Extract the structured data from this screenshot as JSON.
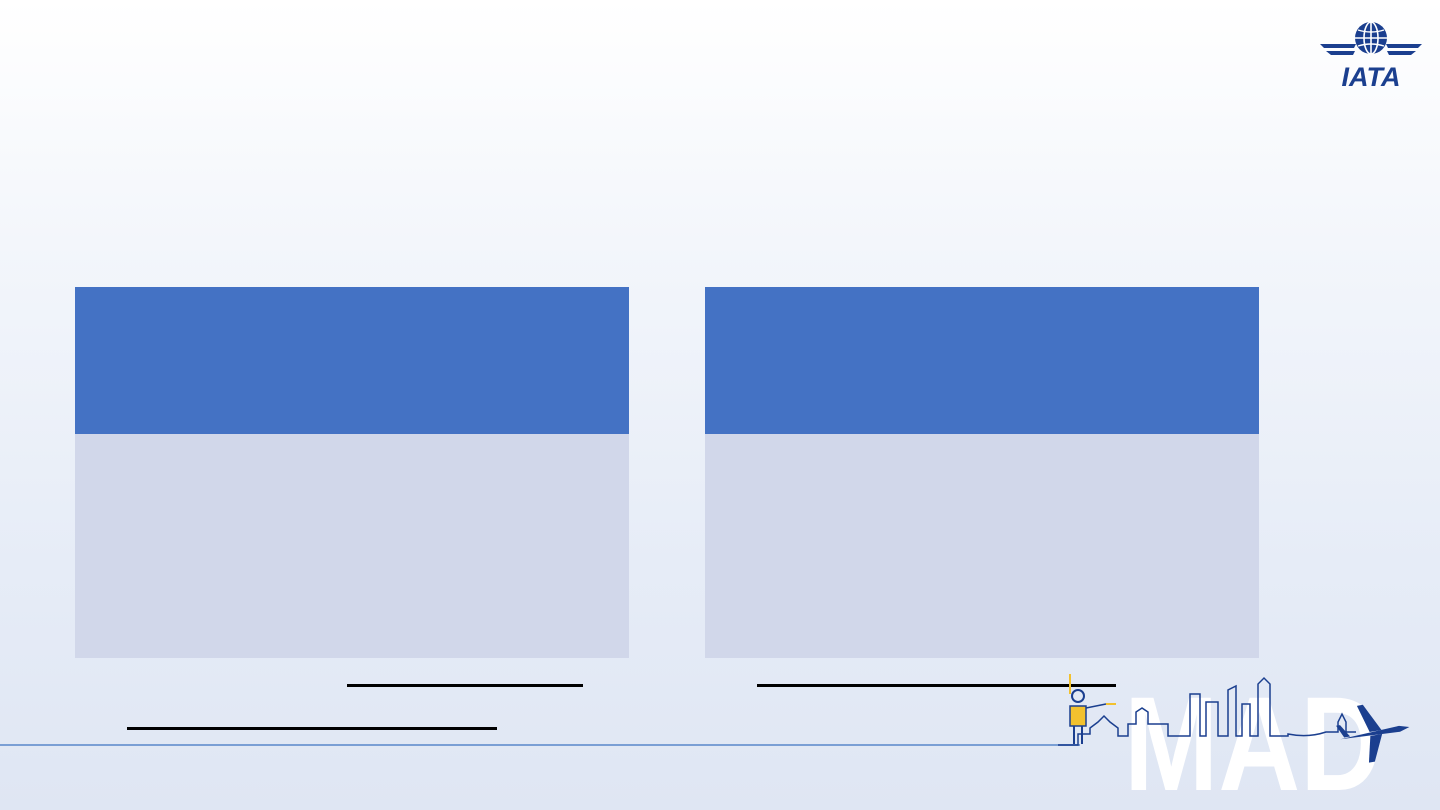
{
  "logo": {
    "text": "IATA",
    "icon": "globe-wings-icon",
    "color": "#1b3f8f"
  },
  "cards": [
    {
      "header_text": "",
      "body_text": ""
    },
    {
      "header_text": "",
      "body_text": ""
    }
  ],
  "branding": {
    "city": "MAD",
    "icons": [
      "ground-crew-icon",
      "madrid-skyline-icon",
      "airplane-icon"
    ]
  },
  "colors": {
    "card_header": "#4472c4",
    "card_body": "#d1d7ea",
    "accent": "#1b3f8f",
    "yellow": "#f2c12e"
  }
}
